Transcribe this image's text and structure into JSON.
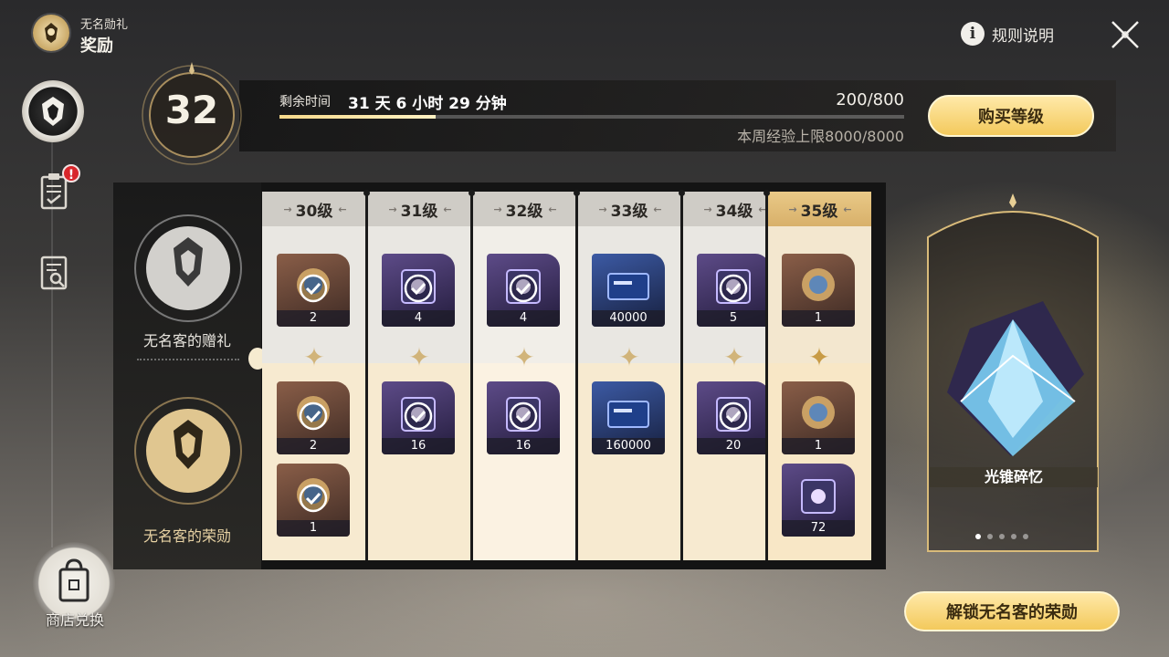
{
  "header": {
    "subtitle": "无名勋礼",
    "title": "奖励"
  },
  "top_right": {
    "rules_label": "规则说明"
  },
  "sidebar": {
    "notification_badge": "!",
    "shop_label": "商店兑换"
  },
  "level": {
    "current": "32",
    "time_label": "剩余时间",
    "time_value": "31 天 6 小时 29 分钟",
    "exp_text": "200/800",
    "exp_fraction": 0.25,
    "weekly_cap_text": "本周经验上限8000/8000",
    "buy_button": "购买等级"
  },
  "tiers": {
    "free_label": "无名客的赠礼",
    "paid_label": "无名客的荣勋"
  },
  "columns": [
    {
      "level": "30级",
      "free": [
        {
          "qty": "2",
          "claimed": true
        }
      ],
      "paid": [
        {
          "qty": "2",
          "claimed": true
        },
        {
          "qty": "1",
          "claimed": true
        }
      ]
    },
    {
      "level": "31级",
      "free": [
        {
          "qty": "4",
          "claimed": true
        }
      ],
      "paid": [
        {
          "qty": "16",
          "claimed": true
        }
      ]
    },
    {
      "level": "32级",
      "free": [
        {
          "qty": "4",
          "claimed": true
        }
      ],
      "paid": [
        {
          "qty": "16",
          "claimed": true
        }
      ]
    },
    {
      "level": "33级",
      "free": [
        {
          "qty": "40000",
          "claimed": false
        }
      ],
      "paid": [
        {
          "qty": "160000",
          "claimed": false
        }
      ]
    },
    {
      "level": "34级",
      "free": [
        {
          "qty": "5",
          "claimed": true
        }
      ],
      "paid": [
        {
          "qty": "20",
          "claimed": true
        }
      ]
    },
    {
      "level": "35级",
      "free": [
        {
          "qty": "1",
          "claimed": false
        }
      ],
      "paid": [
        {
          "qty": "1",
          "claimed": false
        },
        {
          "qty": "72",
          "claimed": false
        }
      ]
    }
  ],
  "showcase": {
    "label": "光锥碎忆",
    "page_count": 5,
    "active_page": 1
  },
  "unlock_button": "解锁无名客的荣勋",
  "colors": {
    "accent_gold": "#f3c95c",
    "badge_red": "#d8262b",
    "progress": "#f7d98b"
  }
}
